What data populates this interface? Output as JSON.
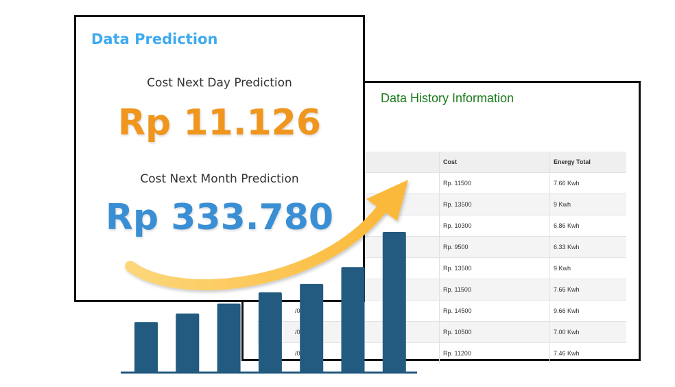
{
  "prediction": {
    "title": "Data Prediction",
    "day_label": "Cost Next Day Prediction",
    "day_value": "Rp 11.126",
    "month_label": "Cost Next Month Prediction",
    "month_value": "Rp 333.780"
  },
  "history": {
    "title": "Data History Information",
    "columns": [
      "",
      "Cost",
      "Energy Total"
    ],
    "rows": [
      {
        "date": "",
        "cost": "Rp. 11500",
        "energy": "7.66 Kwh"
      },
      {
        "date": "",
        "cost": "Rp. 13500",
        "energy": "9 Kwh"
      },
      {
        "date": "",
        "cost": "Rp. 10300",
        "energy": "6.86 Kwh"
      },
      {
        "date": "",
        "cost": "Rp. 9500",
        "energy": "6.33 Kwh"
      },
      {
        "date": "",
        "cost": "Rp. 13500",
        "energy": "9 Kwh"
      },
      {
        "date": "",
        "cost": "Rp. 11500",
        "energy": "7.66 Kwh"
      },
      {
        "date": "/07",
        "cost": "Rp. 14500",
        "energy": "9.66 Kwh"
      },
      {
        "date": "/08",
        "cost": "Rp. 10500",
        "energy": "7.00 Kwh"
      },
      {
        "date": "/09",
        "cost": "Rp. 11200",
        "energy": "7.46 Kwh"
      }
    ]
  },
  "colors": {
    "prediction_title": "#3eaaf0",
    "day_value": "#f0961e",
    "month_value": "#3a8fd4",
    "history_title": "#1a7a1a",
    "bar": "#235a80",
    "arrow": "#fcc24c"
  },
  "decor": {
    "bar_icon": "growth-bar-chart-icon",
    "arrow_icon": "trend-up-arrow-icon",
    "bar_levels": [
      0.36,
      0.42,
      0.49,
      0.57,
      0.63,
      0.75,
      1.0
    ]
  }
}
